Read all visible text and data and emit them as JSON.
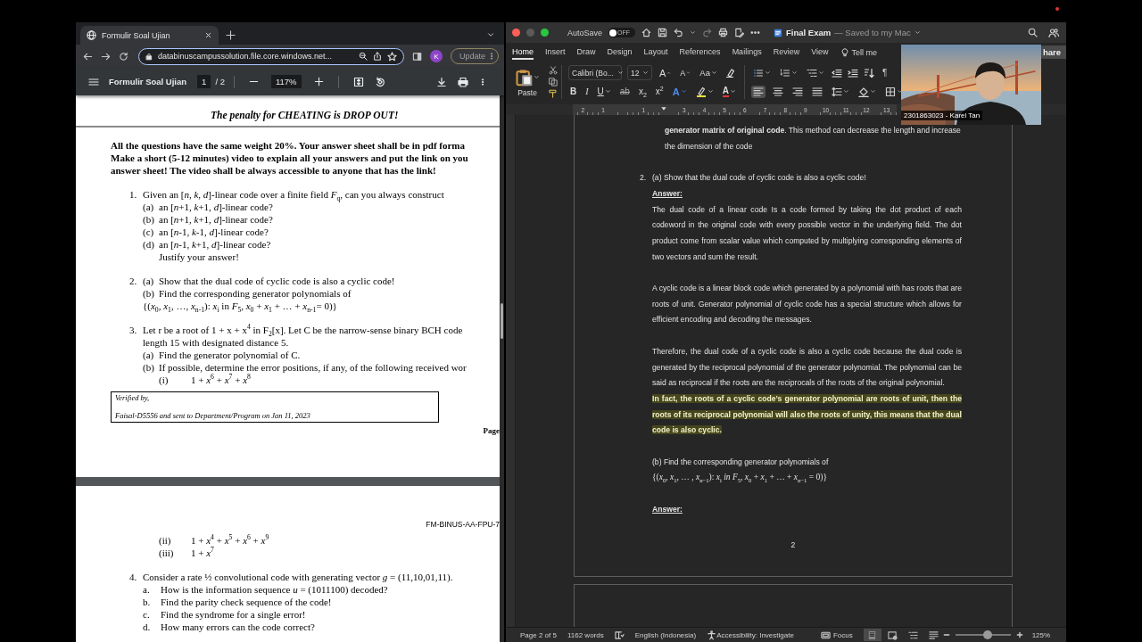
{
  "browser": {
    "tab": {
      "title": "Formulir Soal Ujian",
      "selected": true
    },
    "address": {
      "url": "databinuscampussolution.file.core.windows.net..."
    },
    "profile": {
      "initial": "K"
    },
    "update_button": {
      "label": "Update"
    },
    "pdf_toolbar": {
      "title": "Formulir Soal Ujian",
      "page": "1",
      "page_count": "/ 2",
      "zoom": "117%"
    },
    "pdf_pages": [
      {
        "notice": "The penalty for CHEATING is DROP OUT!",
        "instructions": "All the questions have the same weight 20%. Your answer sheet shall be in pdf forma\nMake a short (5-12 minutes) video to explain all your answers and put the link on you\nanswer sheet! The video shall be always accessible to anyone that has the link!",
        "questions": [
          {
            "number": "1.",
            "lines": [
              {
                "kind": "stem",
                "text": "Given an [*n*, *k*, *d*]-linear code over a finite field *F*$_{q}$, can you always construct"
              },
              {
                "kind": "part",
                "label": "(a)",
                "text": "an [*n*+1, *k*+1, *d*]-linear code?"
              },
              {
                "kind": "part",
                "label": "(b)",
                "text": "an [*n*+1, *k*+1, *d*]-linear code?"
              },
              {
                "kind": "part",
                "label": "(c)",
                "text": "an [*n*-1, *k*-1, *d*]-linear code?"
              },
              {
                "kind": "part",
                "label": "(d)",
                "text": "an [*n*-1, *k*+1, *d*]-linear code?"
              },
              {
                "kind": "cont",
                "text": "Justify your answer!"
              }
            ]
          },
          {
            "number": "2.",
            "lines": [
              {
                "kind": "part",
                "label": "(a)",
                "text": "Show that the dual code of cyclic code is also a cyclic code!"
              },
              {
                "kind": "part",
                "label": "(b)",
                "text": "Find the corresponding generator polynomials of"
              },
              {
                "kind": "stem",
                "text": "{(*x*$_{0}$, *x*$_{1}$, …, *x*$_{n-1}$): *x*$_{i}$ in *F*$_{5}$, *x*$_{0}$ + *x*$_{1}$ + … + *x*$_{n-1}$= 0)}"
              }
            ]
          },
          {
            "number": "3.",
            "lines": [
              {
                "kind": "stem",
                "text": "Let r be a root of 1 + x + x$^{4}$ in F$_{2}$[x]. Let C be the narrow-sense binary BCH code"
              },
              {
                "kind": "stem",
                "text": "length 15 with designated distance 5."
              },
              {
                "kind": "part",
                "label": "(a)",
                "text": "Find the generator polynomial of C."
              },
              {
                "kind": "part",
                "label": "(b)",
                "text": "If possible, determine the error positions, if any, of the following received wor"
              },
              {
                "kind": "case",
                "label": "(i)",
                "text": "1 + *x*$^{6}$ + *x*$^{7}$ + *x*$^{8}$"
              }
            ]
          }
        ],
        "verification": {
          "title": "Verified by,",
          "text": "Faisal-D5556 and sent to Department/Program on Jan 11, 2023"
        },
        "footer": "Page"
      },
      {
        "header": "FM-BINUS-AA-FPU-7",
        "questions": [
          {
            "lines": [
              {
                "kind": "case",
                "label": "(ii)",
                "text": "1 + *x*$^{4}$ + *x*$^{5}$ + *x*$^{6}$ + *x*$^{9}$"
              },
              {
                "kind": "case",
                "label": "(iii)",
                "text": "1 + *x*$^{7}$"
              }
            ]
          },
          {
            "number": "4.",
            "lines": [
              {
                "kind": "stem",
                "text": "Consider a rate ½ convolutional code with generating vector *g* = (11,10,01,11)."
              },
              {
                "kind": "item",
                "label": "a.",
                "text": "How is the information sequence *u* = (1011100) decoded?"
              },
              {
                "kind": "item",
                "label": "b.",
                "text": "Find the parity check sequence of the code!"
              },
              {
                "kind": "item",
                "label": "c.",
                "text": "Find the syndrome for a single error!"
              },
              {
                "kind": "item",
                "label": "d.",
                "text": "How many errors can the code correct?"
              }
            ]
          }
        ]
      }
    ]
  },
  "word": {
    "title_bar": {
      "autosave": "AutoSave",
      "autosave_toggle": {
        "on": false,
        "label": "OFF"
      },
      "document": "Final Exam",
      "status": "— Saved to my Mac"
    },
    "tabs": [
      {
        "label": "Home",
        "selected": true
      },
      {
        "label": "Insert",
        "selected": false
      },
      {
        "label": "Draw",
        "selected": false
      },
      {
        "label": "Design",
        "selected": false
      },
      {
        "label": "Layout",
        "selected": false
      },
      {
        "label": "References",
        "selected": false
      },
      {
        "label": "Mailings",
        "selected": false
      },
      {
        "label": "Review",
        "selected": false
      },
      {
        "label": "View",
        "selected": false
      }
    ],
    "tell_me": "Tell me",
    "share_button": "hare",
    "ribbon": {
      "paste": "Paste",
      "font_name": "Calibri (Bo...",
      "font_size": "12",
      "font_tools": [
        {
          "kind": "grow",
          "label": "A"
        },
        {
          "kind": "shrink",
          "label": "A"
        },
        {
          "kind": "case",
          "label": "Aa"
        }
      ],
      "char_tools": [
        {
          "kind": "bold",
          "label": "B"
        },
        {
          "kind": "italic",
          "label": "I"
        },
        {
          "kind": "underline",
          "label": "U"
        },
        {
          "kind": "strike",
          "label": "ab"
        },
        {
          "kind": "subscript",
          "label": "x$_{2}$"
        },
        {
          "kind": "superscript",
          "label": "x$^{2}$"
        },
        {
          "kind": "effects",
          "label": "A"
        },
        {
          "kind": "highlight"
        },
        {
          "kind": "color",
          "label": "A"
        }
      ],
      "pilcrow": "¶",
      "align_buttons": [
        {
          "kind": "left",
          "selected": true
        },
        {
          "kind": "center",
          "selected": false
        },
        {
          "kind": "right",
          "selected": false
        },
        {
          "kind": "justify",
          "selected": false
        }
      ]
    },
    "ruler": {
      "labels": [
        "2",
        "1",
        "1",
        "3",
        "4",
        "5",
        "6",
        "7",
        "8",
        "9",
        "10",
        "11",
        "12",
        "13"
      ]
    },
    "document": {
      "blocks": [
        {
          "kind": "continuation",
          "text": "**generator matrix of original code**. This method can decrease the length and increase the dimension of the code"
        },
        {
          "kind": "numbered",
          "number": "2.",
          "text": "(a) Show that the dual code of cyclic code is also a cyclic code!"
        },
        {
          "kind": "heading",
          "text": "Answer:"
        },
        {
          "kind": "paragraph",
          "text": "The dual code of a linear code Is a code formed by taking the dot product of each codeword in the original code with every possible vector in the underlying field. The dot product come from scalar value which computed by multiplying corresponding elements of two vectors and sum the result."
        },
        {
          "kind": "paragraph",
          "text": "A cyclic code is a linear block code which generated by a polynomial with has roots that are roots of unit. Generator polynomial of cyclic code has a special structure which allows for efficient encoding and decoding the messages."
        },
        {
          "kind": "paragraph",
          "text": "Therefore, the dual code of a cyclic code is also a cyclic code because the dual code is generated by the reciprocal polynomial of the generator polynomial. The polynomial can be said as reciprocal if the roots are the reciprocals of the roots of the original polynomial.",
          "highlight": "In fact, the roots of a cyclic code’s generator polynomial are roots of unit, then the roots of its reciprocal polynomial will also the roots of unity, this means that the dual code is also cyclic."
        },
        {
          "kind": "plain",
          "text": "(b) Find the corresponding generator polynomials of"
        },
        {
          "kind": "formula",
          "text": "{(*x*$_{0}$, *x*$_{1}$, … , *x*$_{n−1}$): *x*$_{i}$ *in F*$_{5}$, *x*$_{0}$ + *x*$_{1}$ + … + *x*$_{n−1}$ = 0)}"
        },
        {
          "kind": "heading",
          "text": "Answer:"
        }
      ],
      "page_number": "2"
    },
    "status_bar": {
      "page": "Page 2 of 5",
      "words": "1162 words",
      "language": "English (Indonesia)",
      "accessibility": "Accessibility: Investigate",
      "focus": "Focus",
      "views": [
        {
          "kind": "print",
          "selected": true
        },
        {
          "kind": "web",
          "selected": false
        },
        {
          "kind": "outline",
          "selected": false
        },
        {
          "kind": "draft",
          "selected": false
        }
      ],
      "zoom": {
        "level": 0.58,
        "label": "125%"
      }
    }
  },
  "webcam": {
    "kind": "picture",
    "caption": "2301863023 - Karel Tan"
  }
}
